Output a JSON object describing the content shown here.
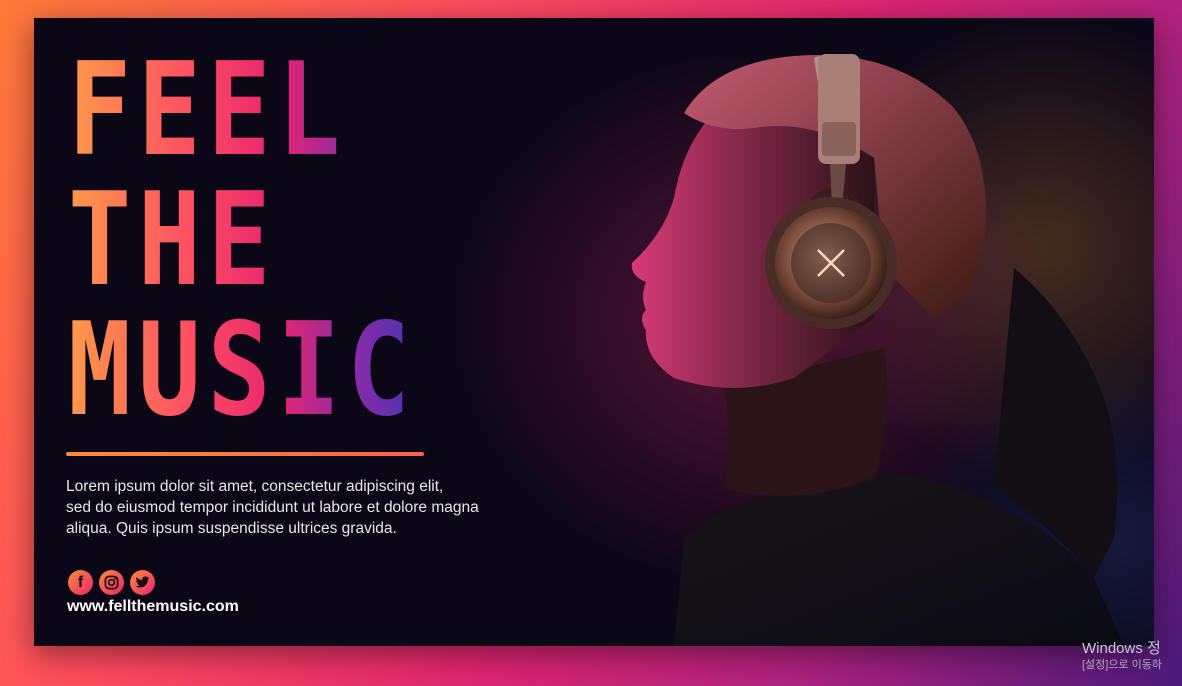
{
  "headline": [
    "FEEL",
    "THE",
    "MUSIC"
  ],
  "body_lines": [
    "Lorem ipsum dolor sit amet, consectetur adipiscing elit,",
    "sed do eiusmod tempor incididunt ut labore et dolore magna",
    "aliqua. Quis ipsum suspendisse ultrices gravida."
  ],
  "socials": [
    {
      "icon": "facebook-icon",
      "glyph": "f"
    },
    {
      "icon": "instagram-icon",
      "glyph": ""
    },
    {
      "icon": "twitter-icon",
      "glyph": ""
    }
  ],
  "website": "www.fellthemusic.com",
  "watermark": [
    "Windows 정",
    "[설정]으로 이동하"
  ],
  "colors": {
    "headline_start": "#ff9a4a",
    "headline_mid": "#e8256e",
    "headline_end": "#4a33b0",
    "banner_bg": "#0c0716",
    "underline": "#ff8a3a"
  }
}
